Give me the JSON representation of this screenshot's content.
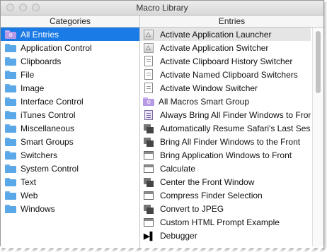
{
  "window": {
    "title": "Macro Library"
  },
  "columns": {
    "categories": "Categories",
    "entries": "Entries"
  },
  "categories": [
    {
      "label": "All Entries",
      "icon": "smart-folder-icon",
      "selected": true
    },
    {
      "label": "Application Control",
      "icon": "folder-icon"
    },
    {
      "label": "Clipboards",
      "icon": "folder-icon"
    },
    {
      "label": "File",
      "icon": "folder-icon"
    },
    {
      "label": "Image",
      "icon": "folder-icon"
    },
    {
      "label": "Interface Control",
      "icon": "folder-icon"
    },
    {
      "label": "iTunes Control",
      "icon": "folder-icon"
    },
    {
      "label": "Miscellaneous",
      "icon": "folder-icon"
    },
    {
      "label": "Smart Groups",
      "icon": "folder-icon"
    },
    {
      "label": "Switchers",
      "icon": "folder-icon"
    },
    {
      "label": "System Control",
      "icon": "folder-icon"
    },
    {
      "label": "Text",
      "icon": "folder-icon"
    },
    {
      "label": "Web",
      "icon": "folder-icon"
    },
    {
      "label": "Windows",
      "icon": "folder-icon"
    }
  ],
  "entries": [
    {
      "label": "Activate Application Launcher",
      "icon": "app-icon",
      "highlighted": true
    },
    {
      "label": "Activate Application Switcher",
      "icon": "app-icon"
    },
    {
      "label": "Activate Clipboard History Switcher",
      "icon": "document-icon"
    },
    {
      "label": "Activate Named Clipboard Switchers",
      "icon": "document-icon"
    },
    {
      "label": "Activate Window Switcher",
      "icon": "document-icon"
    },
    {
      "label": "All Macros Smart Group",
      "icon": "smart-folder-icon"
    },
    {
      "label": "Always Bring All Finder Windows to Front",
      "icon": "list-icon"
    },
    {
      "label": "Automatically Resume Safari's Last Session",
      "icon": "stack-icon"
    },
    {
      "label": "Bring All Finder Windows to the Front",
      "icon": "stack-icon"
    },
    {
      "label": "Bring Application Windows to Front",
      "icon": "window-icon"
    },
    {
      "label": "Calculate",
      "icon": "window-icon"
    },
    {
      "label": "Center the Front Window",
      "icon": "stack-icon"
    },
    {
      "label": "Compress Finder Selection",
      "icon": "window-icon"
    },
    {
      "label": "Convert to JPEG",
      "icon": "stack-icon"
    },
    {
      "label": "Custom HTML Prompt Example",
      "icon": "window-icon"
    },
    {
      "label": "Debugger",
      "icon": "play-icon"
    }
  ],
  "colors": {
    "selection": "#1a7ae6",
    "folder": "#5aa8e8",
    "smart_folder": "#b79ae6"
  }
}
